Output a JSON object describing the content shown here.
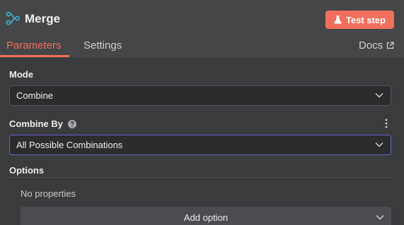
{
  "header": {
    "title": "Merge",
    "node_icon": "merge-icon",
    "test_step_label": "Test step",
    "test_step_icon": "flask-icon"
  },
  "tabs": [
    {
      "label": "Parameters",
      "active": true
    },
    {
      "label": "Settings",
      "active": false
    }
  ],
  "docs": {
    "label": "Docs",
    "icon": "external-link-icon"
  },
  "mode": {
    "label": "Mode",
    "value": "Combine"
  },
  "combine_by": {
    "label": "Combine By",
    "value": "All Possible Combinations",
    "help_icon": "question-circle-icon"
  },
  "options": {
    "label": "Options",
    "empty_text": "No properties",
    "add_label": "Add option"
  },
  "colors": {
    "accent": "#f16f5d",
    "focus_border": "#6a64c8",
    "header_bg": "#454648",
    "panel_bg": "#3a3b3d",
    "input_bg": "#2b2c2e",
    "node_icon": "#3fb2c9"
  }
}
